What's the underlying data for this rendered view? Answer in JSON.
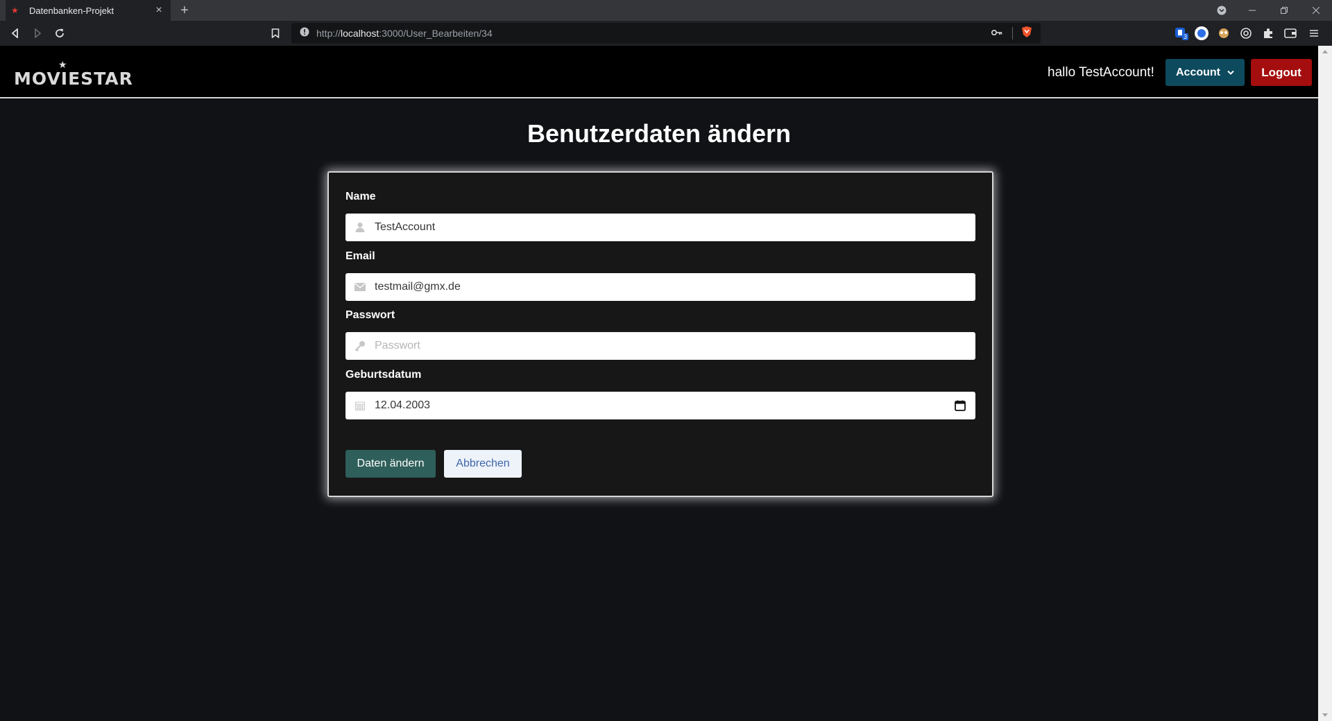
{
  "browser": {
    "tab_title": "Datenbanken-Projekt",
    "tab_close": "×",
    "new_tab": "+",
    "url_prefix": "http://",
    "url_host": "localhost",
    "url_path": ":3000/User_Bearbeiten/34",
    "extension_badge": "3"
  },
  "navbar": {
    "logo": "MOVIESTAR",
    "greeting": "hallo TestAccount!",
    "account_label": "Account",
    "logout_label": "Logout"
  },
  "form": {
    "heading": "Benutzerdaten ändern",
    "name_label": "Name",
    "name_value": "TestAccount",
    "email_label": "Email",
    "email_value": "testmail@gmx.de",
    "password_label": "Passwort",
    "password_placeholder": "Passwort",
    "birthdate_label": "Geburtsdatum",
    "birthdate_value": "12.04.2003",
    "save_label": "Daten ändern",
    "cancel_label": "Abbrechen"
  },
  "colors": {
    "account_button": "#0d4a5e",
    "logout_button": "#a50e0e",
    "save_button": "#2f5f5a",
    "cancel_button": "#eef3fa"
  }
}
